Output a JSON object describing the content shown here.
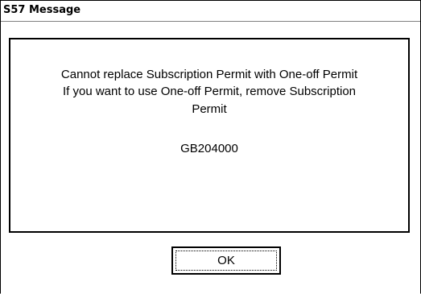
{
  "dialog": {
    "title": "S57 Message"
  },
  "message": {
    "line1": "Cannot replace Subscription Permit with One-off Permit",
    "line2": "If you want to use One-off Permit, remove Subscription",
    "line3": "Permit",
    "code": "GB204000"
  },
  "buttons": {
    "ok_label": "OK"
  }
}
